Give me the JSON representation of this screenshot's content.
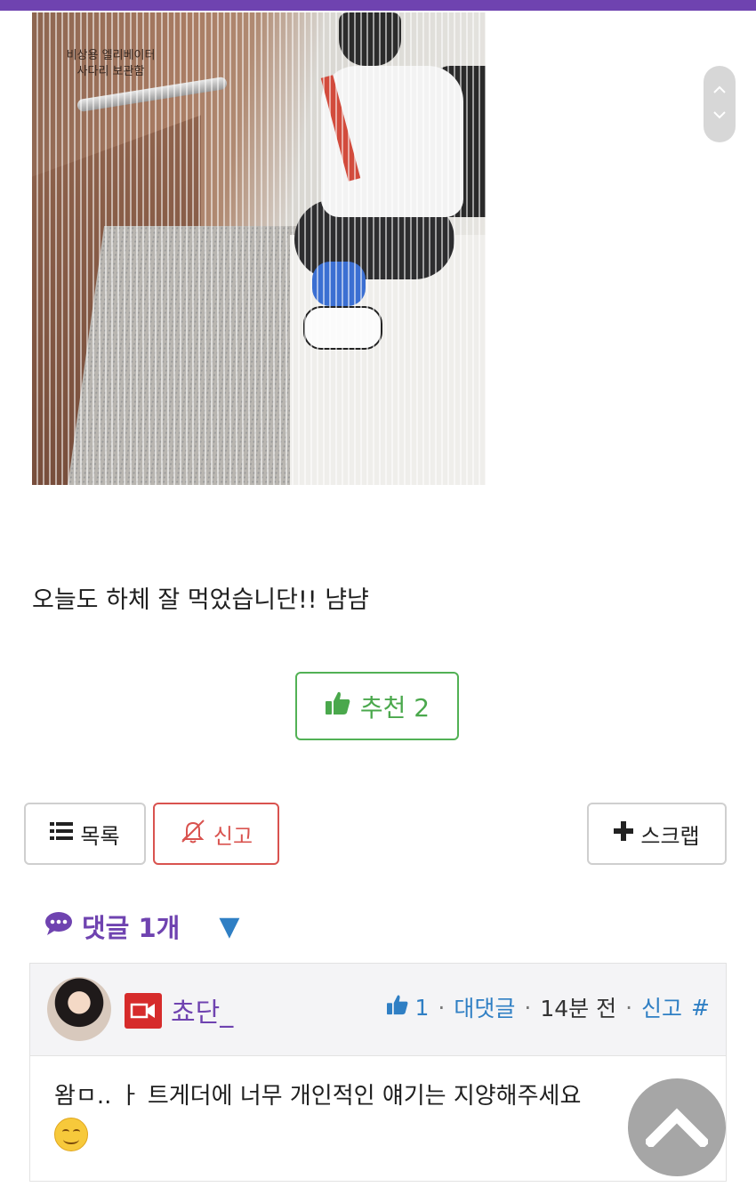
{
  "post": {
    "image_caption_line1": "비상용 엘리베이터",
    "image_caption_line2": "사다리 보관함",
    "text": "오늘도 하체 잘 먹었습니단!! 냠냠",
    "recommend_label": "추천 2"
  },
  "actions": {
    "list_label": "목록",
    "report_label": "신고",
    "scrap_label": "스크랩"
  },
  "comments": {
    "header": "댓글 1개",
    "toggle_symbol": "▼",
    "items": [
      {
        "nickname": "쵸단_",
        "likes": "1",
        "reply_label": "대댓글",
        "time": "14분 전",
        "report_label": "신고",
        "hash": "#",
        "text": "왐ㅁ.. ㅏ 트게더에 너무 개인적인 얘기는 지양해주세요"
      }
    ]
  },
  "colors": {
    "brand_purple": "#6f43b0",
    "recommend_green": "#52b155",
    "report_red": "#d9534f",
    "link_blue": "#2f7fc4"
  },
  "icons": {
    "thumbs_up": "thumbs-up-icon",
    "list": "list-icon",
    "bell_slash": "bell-slash-icon",
    "plus": "plus-icon",
    "comment": "comment-bubble-icon",
    "level_badge": "video-camera-icon",
    "scroll_up": "chevron-up-icon",
    "scroll_down": "chevron-down-icon",
    "back_to_top": "back-to-top-icon"
  }
}
